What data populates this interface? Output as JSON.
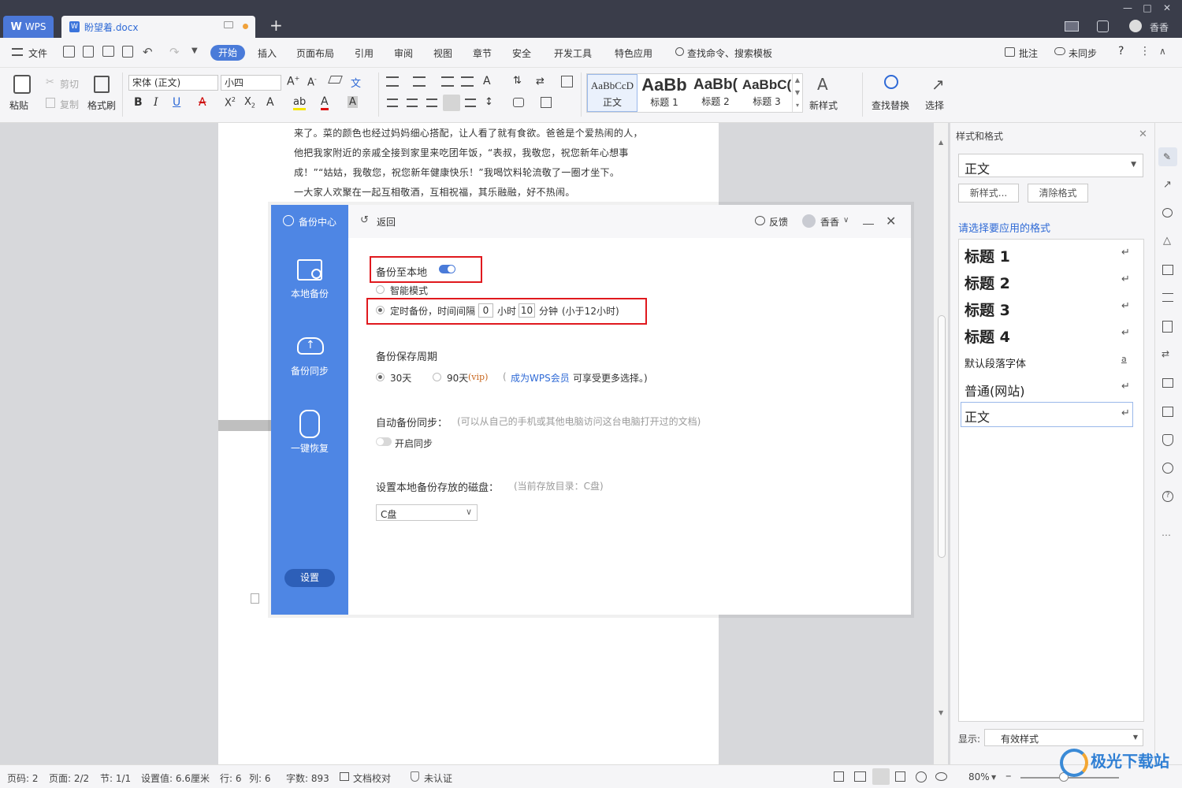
{
  "titlebar": {
    "app_tab": "WPS",
    "doc_tab": "盼望着.docx",
    "new_tab": "+",
    "user": "香香"
  },
  "menubar": {
    "file": "文件",
    "items": [
      "开始",
      "插入",
      "页面布局",
      "引用",
      "审阅",
      "视图",
      "章节",
      "安全",
      "开发工具",
      "特色应用"
    ],
    "search": "查找命令、搜索模板",
    "comment": "批注",
    "sync": "未同步",
    "help": "?"
  },
  "ribbon": {
    "paste": "粘贴",
    "cut": "剪切",
    "copy": "复制",
    "format_painter": "格式刷",
    "font_name": "宋体 (正文)",
    "font_size": "小四",
    "styles": [
      {
        "preview": "AaBbCcD",
        "label": "正文"
      },
      {
        "preview": "AaBb",
        "label": "标题 1"
      },
      {
        "preview": "AaBb(",
        "label": "标题 2"
      },
      {
        "preview": "AaBbC(",
        "label": "标题 3"
      }
    ],
    "new_style": "新样式",
    "find_replace": "查找替换",
    "select": "选择"
  },
  "document": {
    "lines": [
      "来了。菜的颜色也经过妈妈细心搭配，让人看了就有食欲。爸爸是个爱热闹的人，",
      "他把我家附近的亲戚全接到家里来吃团年饭，“表叔，我敬您，祝您新年心想事",
      "成！”“姑姑，我敬您，祝您新年健康快乐！”我喝饮料轮流敬了一圈才坐下。",
      "一大家人欢聚在一起互相敬酒，互相祝福，其乐融融，好不热闹。"
    ]
  },
  "dialog": {
    "brand": "备份中心",
    "back": "返回",
    "feedback": "反馈",
    "user": "香香",
    "nav": [
      "本地备份",
      "备份同步",
      "一键恢复"
    ],
    "settings_button": "设置",
    "backup_local_label": "备份至本地",
    "backup_local_on": true,
    "smart_mode": "智能模式",
    "timed_prefix": "定时备份，时间间隔",
    "hours_value": "0",
    "hours_unit": "小时",
    "minutes_value": "10",
    "minutes_unit": "分钟",
    "timed_suffix": "(小于12小时)",
    "period_title": "备份保存周期",
    "period_30": "30天",
    "period_90": "90天",
    "vip": "(vip)",
    "become_member_prefix": "(",
    "become_member": "成为WPS会员",
    "become_member_suffix": "可享受更多选择。)",
    "auto_sync_title": "自动备份同步：",
    "auto_sync_hint": "(可以从自己的手机或其他电脑访问这台电脑打开过的文档)",
    "auto_sync_toggle": "开启同步",
    "disk_title": "设置本地备份存放的磁盘：",
    "disk_hint": "(当前存放目录：C盘)",
    "disk_value": "C盘"
  },
  "style_panel": {
    "title": "样式和格式",
    "current_style": "正文",
    "new_style": "新样式...",
    "clear_format": "清除格式",
    "prompt": "请选择要应用的格式",
    "styles": [
      "标题 1",
      "标题 2",
      "标题 3",
      "标题 4",
      "默认段落字体",
      "普通(网站)",
      "正文"
    ],
    "show_label": "显示:",
    "show_value": "有效样式"
  },
  "statusbar": {
    "page_code": "页码: 2",
    "page": "页面: 2/2",
    "section": "节: 1/1",
    "setting": "设置值: 6.6厘米",
    "row": "行: 6",
    "col": "列: 6",
    "words": "字数: 893",
    "proofread": "文档校对",
    "auth": "未认证",
    "zoom": "80%"
  },
  "watermark": "极光下载站",
  "colors": {
    "accent": "#4a7bd9",
    "sidebar": "#4e86e4",
    "highlight_box": "#e0191e",
    "titlebar": "#3a3d4a"
  }
}
